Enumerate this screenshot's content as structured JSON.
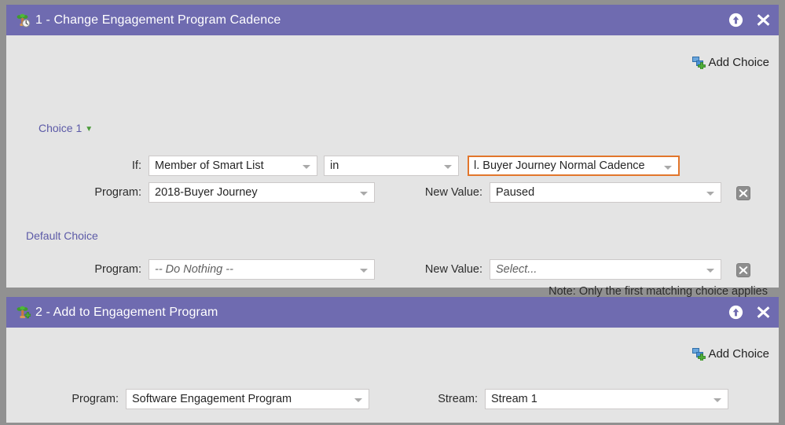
{
  "page": {
    "background_color": "#919191",
    "panel_background": "#e4e4e4",
    "header_color": "#6f6bb0",
    "accent_focus_color": "#e2762c",
    "link_color": "#5c5aa7"
  },
  "panels": [
    {
      "id": "panel-1",
      "icon": "engagement-program-cadence-icon",
      "title": "1 - Change Engagement Program Cadence",
      "actions": {
        "info_icon": "info-circle-icon",
        "close_icon": "close-icon"
      },
      "add_choice": {
        "label": "Add Choice",
        "icon": "add-choice-icon"
      },
      "choice": {
        "label": "Choice 1",
        "caret_icon": "chevron-down-icon"
      },
      "if_row": {
        "label": "If:",
        "attribute_select": {
          "value": "Member of Smart List",
          "chevron_icon": "chevron-down-icon"
        },
        "operator_select": {
          "value": "in",
          "chevron_icon": "chevron-down-icon"
        },
        "value_select": {
          "value": "l. Buyer Journey Normal Cadence",
          "chevron_icon": "chevron-down-icon",
          "focused": true
        }
      },
      "action_row": {
        "program_label": "Program:",
        "program_select": {
          "value": "2018-Buyer Journey",
          "chevron_icon": "chevron-down-icon"
        },
        "new_value_label": "New Value:",
        "new_value_select": {
          "value": "Paused",
          "chevron_icon": "chevron-down-icon"
        },
        "delete_icon": "delete-row-icon"
      },
      "default_choice": {
        "label": "Default Choice",
        "program_label": "Program:",
        "program_select": {
          "value": "-- Do Nothing --",
          "placeholder": true,
          "chevron_icon": "chevron-down-icon"
        },
        "new_value_label": "New Value:",
        "new_value_select": {
          "value": "Select...",
          "placeholder": true,
          "chevron_icon": "chevron-down-icon"
        },
        "delete_icon": "delete-row-icon"
      },
      "note": "Note: Only the first matching choice applies"
    },
    {
      "id": "panel-2",
      "icon": "add-engagement-program-icon",
      "title": "2 - Add to Engagement Program",
      "actions": {
        "info_icon": "info-circle-icon",
        "close_icon": "close-icon"
      },
      "add_choice": {
        "label": "Add Choice",
        "icon": "add-choice-icon"
      },
      "row": {
        "program_label": "Program:",
        "program_select": {
          "value": "Software Engagement Program",
          "chevron_icon": "chevron-down-icon"
        },
        "stream_label": "Stream:",
        "stream_select": {
          "value": "Stream 1",
          "chevron_icon": "chevron-down-icon"
        }
      }
    }
  ]
}
